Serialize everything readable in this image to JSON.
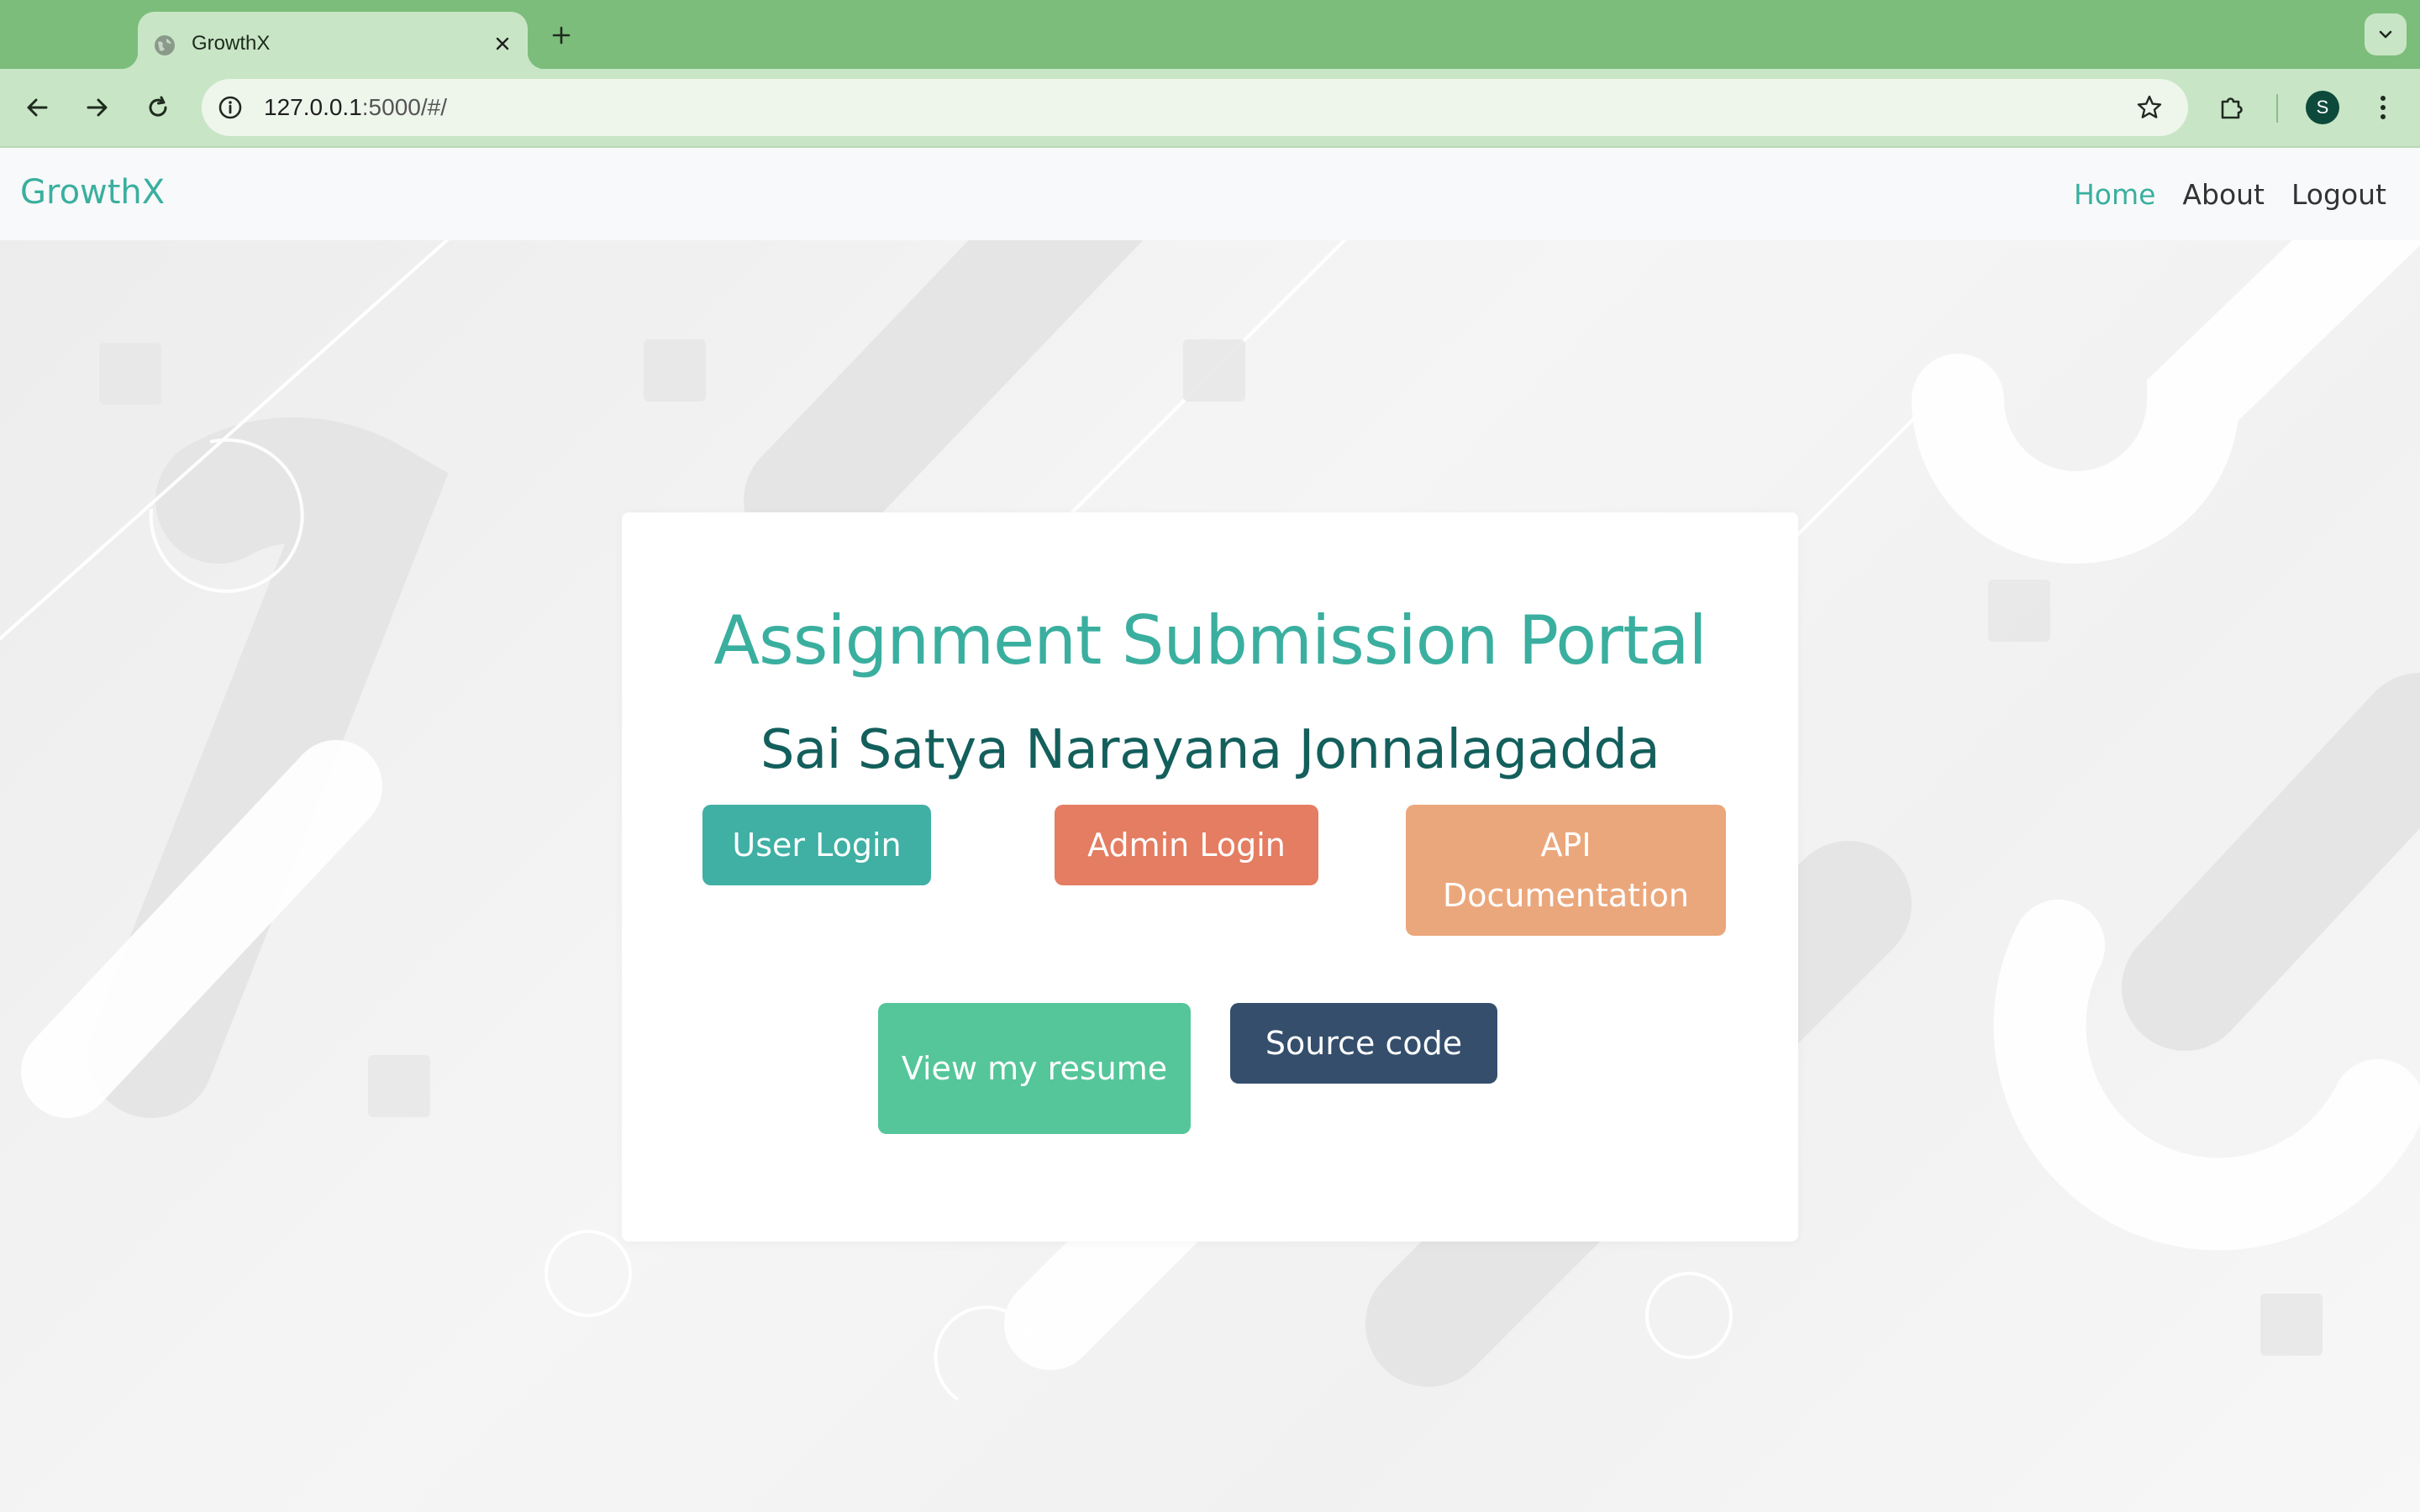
{
  "browser": {
    "tab": {
      "title": "GrowthX",
      "favicon": "globe-icon"
    },
    "url": {
      "host": "127.0.0.1",
      "rest": ":5000/#/"
    },
    "profile_initial": "S"
  },
  "navbar": {
    "brand": "GrowthX",
    "links": [
      {
        "label": "Home",
        "active": true
      },
      {
        "label": "About",
        "active": false
      },
      {
        "label": "Logout",
        "active": false
      }
    ]
  },
  "main": {
    "title": "Assignment Submission Portal",
    "subtitle": "Sai Satya Narayana Jonnalagadda",
    "buttons": {
      "user_login": "User Login",
      "admin_login": "Admin Login",
      "api_docs": "API Documentation",
      "resume": "View my resume",
      "source_code": "Source code"
    }
  },
  "colors": {
    "browser_frame": "#7cbd7b",
    "brand_accent": "#3aaf9f",
    "subtitle": "#135f5c",
    "user_login": "#3fb0a3",
    "admin_login": "#e47d62",
    "api_docs": "#eba77c",
    "resume": "#54c69a",
    "source_code": "#344e6c"
  }
}
